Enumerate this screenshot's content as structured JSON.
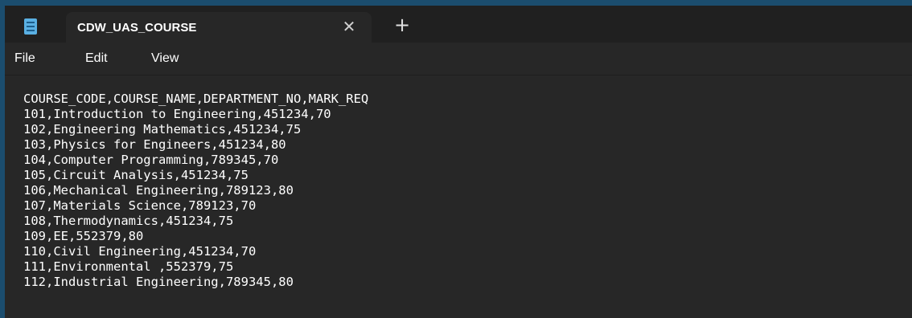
{
  "app": {
    "icon": "notepad-icon"
  },
  "tab": {
    "title": "CDW_UAS_COURSE",
    "close_glyph": "✕",
    "new_tab_glyph": "+"
  },
  "menu": {
    "items": [
      {
        "label": "File"
      },
      {
        "label": "Edit"
      },
      {
        "label": "View"
      }
    ]
  },
  "document": {
    "lines": [
      "COURSE_CODE,COURSE_NAME,DEPARTMENT_NO,MARK_REQ",
      "101,Introduction to Engineering,451234,70",
      "102,Engineering Mathematics,451234,75",
      "103,Physics for Engineers,451234,80",
      "104,Computer Programming,789345,70",
      "105,Circuit Analysis,451234,75",
      "106,Mechanical Engineering,789123,80",
      "107,Materials Science,789123,70",
      "108,Thermodynamics,451234,75",
      "109,EE,552379,80",
      "110,Civil Engineering,451234,70",
      "111,Environmental ,552379,75",
      "112,Industrial Engineering,789345,80"
    ]
  },
  "colors": {
    "desktop": "#1b4d6e",
    "titlebar": "#202020",
    "editor": "#272727",
    "text": "#ffffff",
    "icon_accent": "#5ab0e3"
  }
}
